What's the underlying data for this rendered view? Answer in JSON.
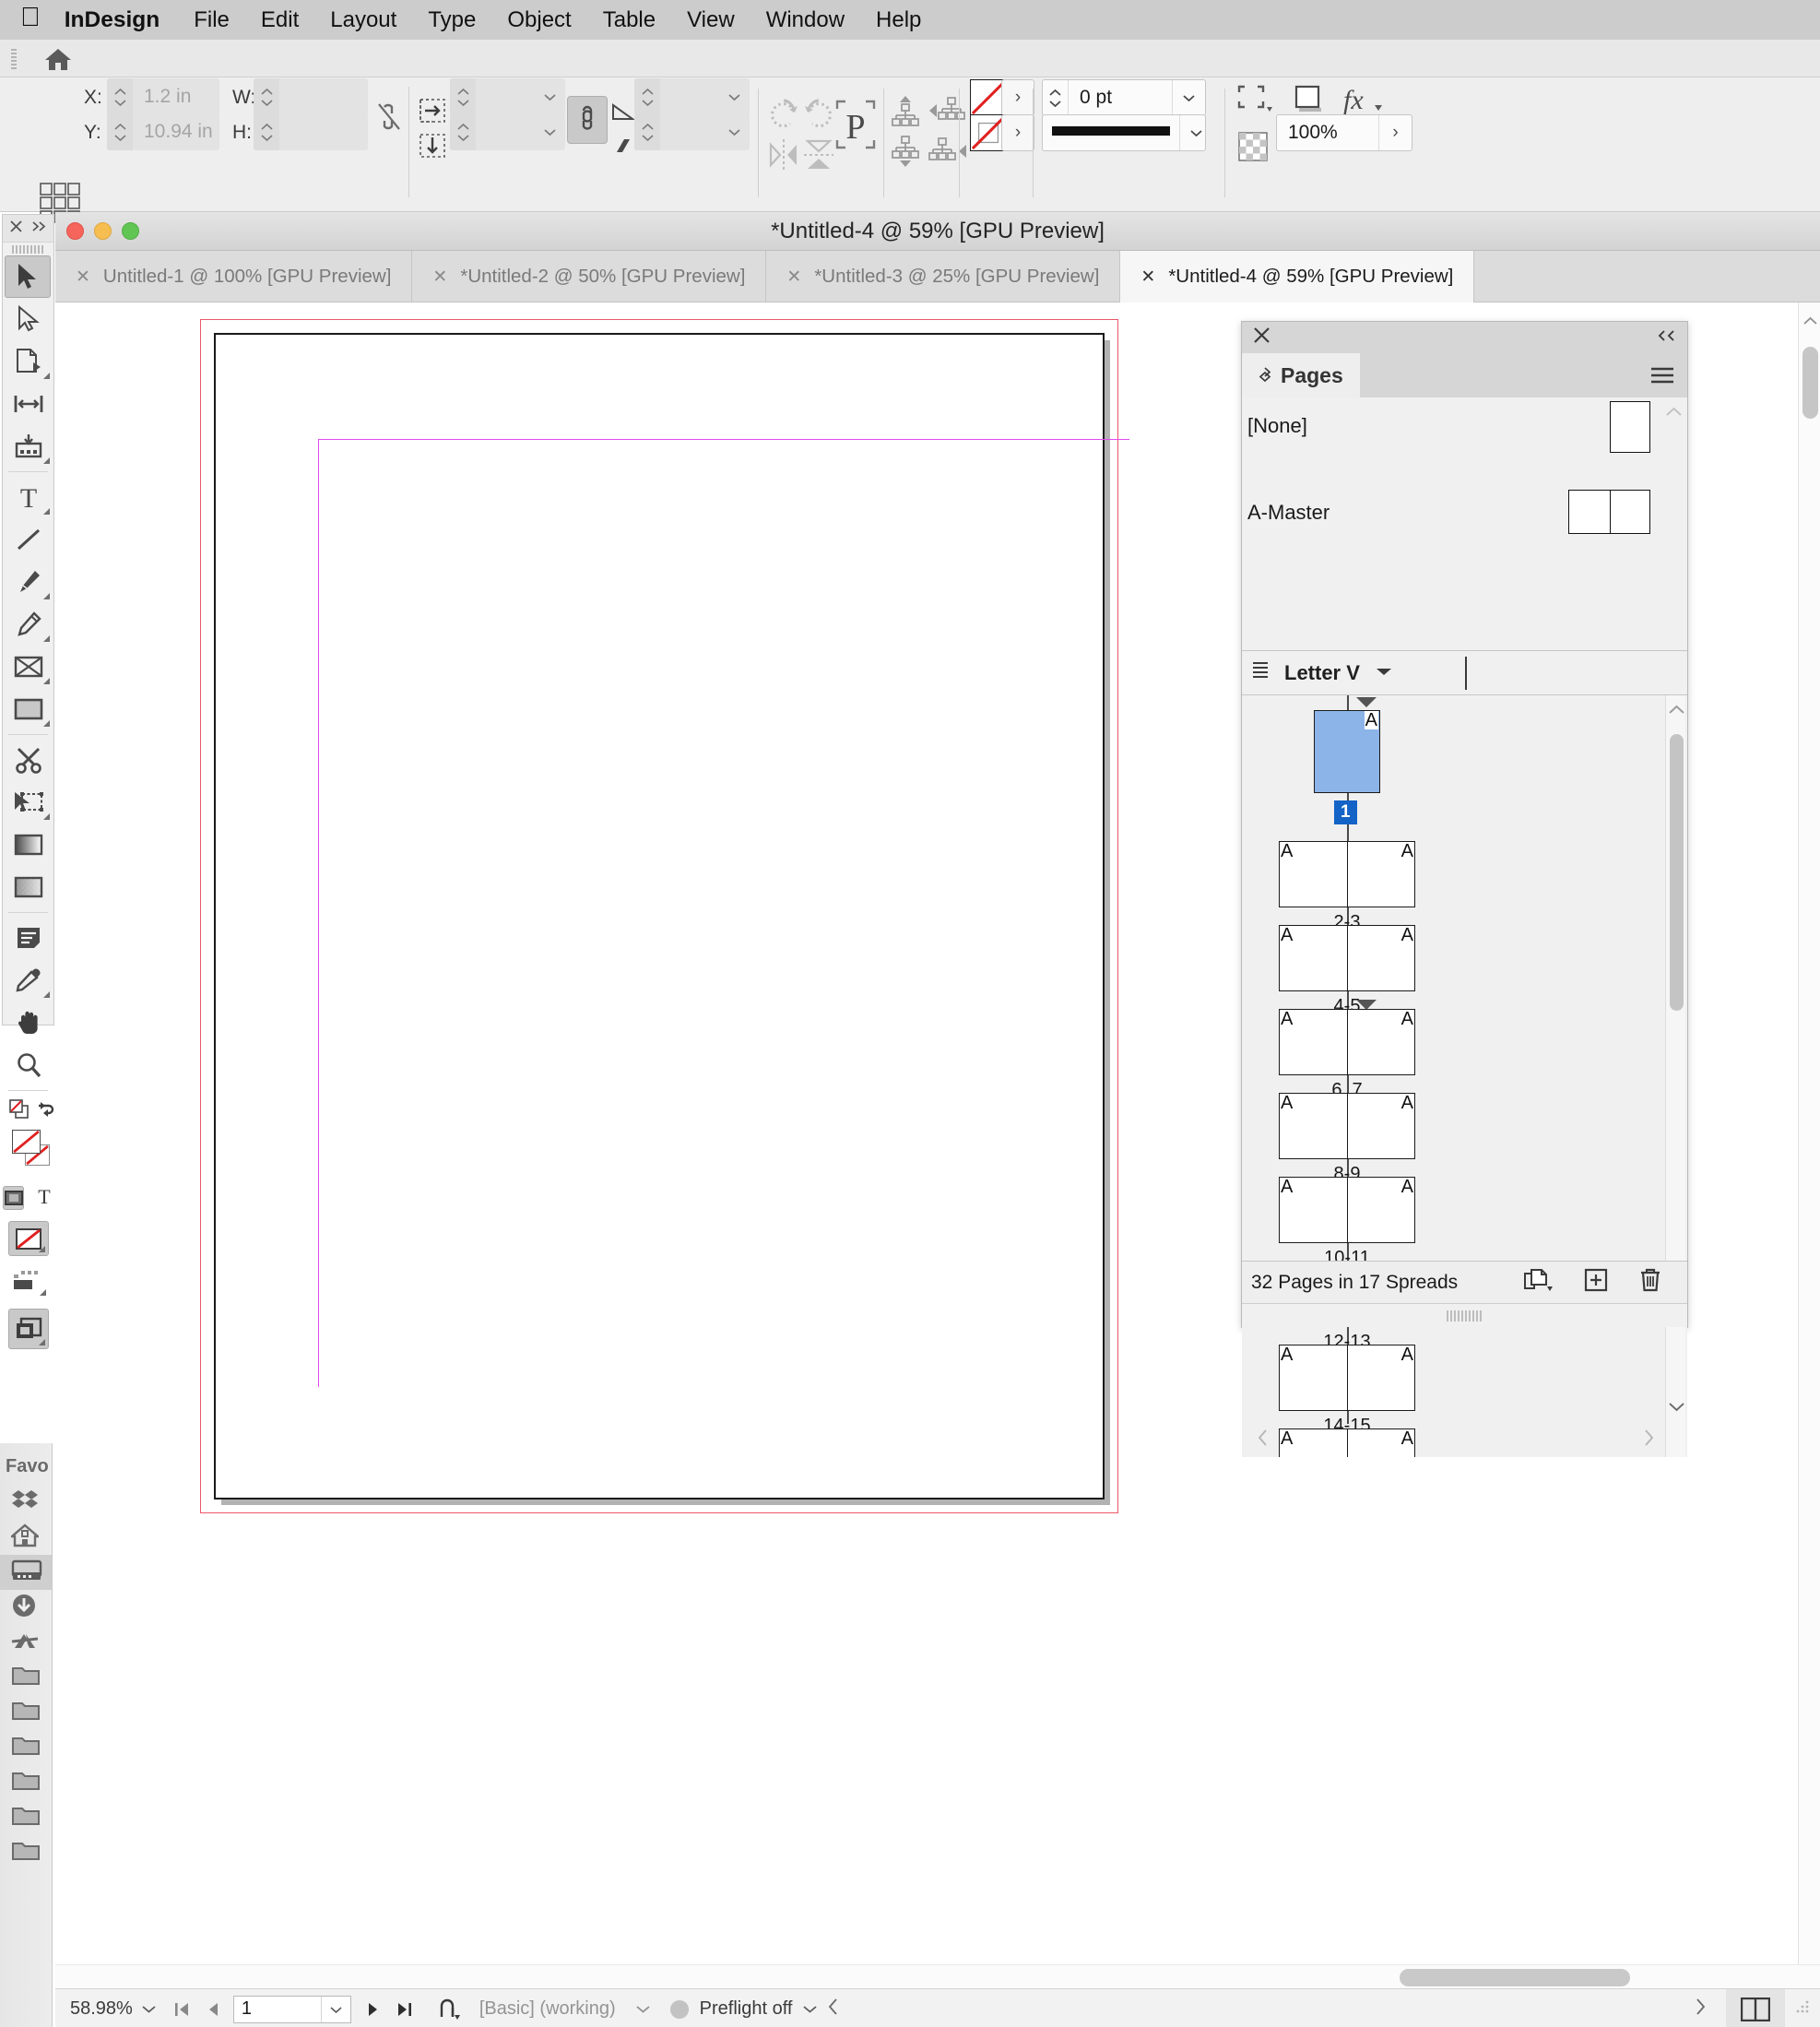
{
  "menubar": {
    "apple_icon": "apple-logo-icon",
    "items": [
      "InDesign",
      "File",
      "Edit",
      "Layout",
      "Type",
      "Object",
      "Table",
      "View",
      "Window",
      "Help"
    ]
  },
  "appbar": {
    "home_icon": "home-icon"
  },
  "control_panel": {
    "reference_point_icon": "reference-point-proxy-icon",
    "x_label": "X:",
    "x_value": "1.2 in",
    "y_label": "Y:",
    "y_value": "10.94 in",
    "w_label": "W:",
    "w_value": "",
    "h_label": "H:",
    "h_value": "",
    "constrain_icon": "broken-chain-link-icon",
    "scale_x_icon": "scale-horizontal-icon",
    "scale_y_icon": "scale-vertical-icon",
    "scale_x_value": "",
    "scale_y_value": "",
    "link_scale_icon": "chain-link-icon",
    "rotation_icon": "rotation-angle-icon",
    "rotation_value": "",
    "shear_icon": "shear-icon",
    "shear_value": "",
    "rotate_cw_icon": "rotate-clockwise-icon",
    "rotate_ccw_icon": "rotate-counterclockwise-icon",
    "flip_h_icon": "flip-horizontal-icon",
    "flip_v_icon": "flip-vertical-icon",
    "container_icon": "select-container-p-icon",
    "select_prev_icon": "select-previous-object-icon",
    "select_next_icon": "select-next-object-icon",
    "select_parent_icon": "select-parent-icon",
    "select_child_icon": "select-child-icon",
    "fill_swatch": "none-fill-icon",
    "stroke_swatch": "none-stroke-icon",
    "stroke_weight_value": "0 pt",
    "stroke_style_icon": "solid-stroke-line",
    "corner_options_icon": "corner-options-icon",
    "drop_shadow_icon": "drop-shadow-icon",
    "effects_icon": "fx-effects-icon",
    "opacity_icon": "transparency-grid-icon",
    "opacity_value": "100%"
  },
  "toolbox": {
    "close_icon": "close-icon",
    "expand_icon": "expand-panel-icon",
    "tools": [
      {
        "name": "selection-tool",
        "selected": true
      },
      {
        "name": "direct-selection-tool",
        "selected": false
      },
      {
        "name": "page-tool",
        "selected": false
      },
      {
        "name": "gap-tool",
        "selected": false
      },
      {
        "name": "content-collector-tool",
        "selected": false
      },
      {
        "name": "type-tool",
        "selected": false
      },
      {
        "name": "line-tool",
        "selected": false
      },
      {
        "name": "pen-tool",
        "selected": false
      },
      {
        "name": "pencil-tool",
        "selected": false
      },
      {
        "name": "frame-tool",
        "selected": false
      },
      {
        "name": "rectangle-tool",
        "selected": false
      },
      {
        "name": "scissors-tool",
        "selected": false
      },
      {
        "name": "free-transform-tool",
        "selected": false
      },
      {
        "name": "gradient-swatch-tool",
        "selected": false
      },
      {
        "name": "gradient-feather-tool",
        "selected": false
      },
      {
        "name": "note-tool",
        "selected": false
      },
      {
        "name": "eyedropper-tool",
        "selected": false
      },
      {
        "name": "hand-tool",
        "selected": false
      },
      {
        "name": "zoom-tool",
        "selected": false
      }
    ],
    "swap_fill_stroke_icon": "swap-fill-stroke-icon",
    "default_fill_stroke_icon": "default-fill-stroke-icon",
    "fill_box_icon": "fill-none-box-icon",
    "stroke_box_icon": "stroke-none-box-icon",
    "formatting_container_icon": "formatting-affects-container-icon",
    "formatting_text_icon": "formatting-affects-text-icon",
    "apply_none_icon": "apply-none-icon",
    "normal_view_icon": "normal-view-mode-icon",
    "preview_view_icon": "preview-view-mode-icon"
  },
  "finder_sidebar": {
    "title": "Favo",
    "items": [
      {
        "name": "dropbox-icon",
        "selected": false
      },
      {
        "name": "home-folder-icon",
        "selected": false
      },
      {
        "name": "desktop-icon",
        "selected": true
      },
      {
        "name": "downloads-icon",
        "selected": false
      },
      {
        "name": "applications-icon",
        "selected": false
      },
      {
        "name": "folder-icon",
        "selected": false
      },
      {
        "name": "folder-icon",
        "selected": false
      },
      {
        "name": "folder-icon",
        "selected": false
      },
      {
        "name": "folder-icon",
        "selected": false
      },
      {
        "name": "folder-icon",
        "selected": false
      },
      {
        "name": "folder-icon",
        "selected": false
      }
    ]
  },
  "document_window": {
    "title": "*Untitled-4 @ 59% [GPU Preview]",
    "traffic_lights": [
      "close-button",
      "minimize-button",
      "zoom-button"
    ],
    "tabs": [
      {
        "label": "Untitled-1 @ 100% [GPU Preview]",
        "active": false
      },
      {
        "label": "*Untitled-2 @ 50% [GPU Preview]",
        "active": false
      },
      {
        "label": "*Untitled-3 @ 25% [GPU Preview]",
        "active": false
      },
      {
        "label": "*Untitled-4 @ 59% [GPU Preview]",
        "active": true
      }
    ],
    "canvas": {
      "bleed_guide_color": "#ec5768",
      "page_border_color": "#1a1a1a",
      "margin_guide_color": "#e24bf0",
      "page_background": "#ffffff"
    },
    "status_bar": {
      "zoom_value": "58.98%",
      "zoom_chevron_icon": "chevron-down-icon",
      "first_page_icon": "first-page-icon",
      "prev_page_icon": "previous-page-icon",
      "page_number": "1",
      "page_dropdown_icon": "chevron-down-icon",
      "next_page_icon": "next-page-icon",
      "last_page_icon": "last-page-icon",
      "no_errors_icon": "no-errors-icon",
      "style_text": "[Basic] (working)",
      "style_chevron_icon": "chevron-down-icon",
      "preflight_status_icon": "preflight-status-dot",
      "preflight_text": "Preflight off",
      "preflight_chevron_icon": "chevron-down-icon",
      "collapse_left_icon": "chevron-left-icon",
      "expand_right_icon": "chevron-right-icon",
      "split_view_icon": "split-window-icon",
      "resize_grip_icon": "resize-grip-icon"
    },
    "vertical_scrollbar_icon": "scroll-up-arrow-icon"
  },
  "pages_panel": {
    "close_icon": "close-icon",
    "collapse_icon": "collapse-to-icons-icon",
    "tab_label": "Pages",
    "tab_diamond_icon": "panel-diamond-icon",
    "menu_icon": "panel-menu-hamburger-icon",
    "masters": [
      {
        "name": "[None]",
        "kind": "single"
      },
      {
        "name": "A-Master",
        "kind": "spread"
      }
    ],
    "page_size": {
      "list_icon": "page-size-list-icon",
      "label": "Letter V",
      "chevron_icon": "chevron-down-icon"
    },
    "spreads": [
      {
        "label": "",
        "pages": 1,
        "selected": true,
        "markers": [
          "A"
        ],
        "badge": "1",
        "triangle": true
      },
      {
        "label": "2-3",
        "pages": 2,
        "selected": false,
        "markers": [
          "A",
          "A"
        ],
        "triangle": false
      },
      {
        "label": "4-5",
        "pages": 2,
        "selected": false,
        "markers": [
          "A",
          "A"
        ],
        "triangle": false
      },
      {
        "label": "6, 7",
        "pages": 2,
        "selected": false,
        "markers": [
          "A",
          "A"
        ],
        "triangle": true
      },
      {
        "label": "8-9",
        "pages": 2,
        "selected": false,
        "markers": [
          "A",
          "A"
        ],
        "triangle": false
      },
      {
        "label": "10-11",
        "pages": 2,
        "selected": false,
        "markers": [
          "A",
          "A"
        ],
        "triangle": false
      },
      {
        "label": "12-13",
        "pages": 2,
        "selected": false,
        "markers": [
          "A",
          "A"
        ],
        "triangle": false
      },
      {
        "label": "14-15",
        "pages": 2,
        "selected": false,
        "markers": [
          "A",
          "A"
        ],
        "triangle": false
      },
      {
        "label": "",
        "pages": 2,
        "selected": false,
        "markers": [
          "A",
          "A"
        ],
        "triangle": false
      }
    ],
    "footer": {
      "count_text": "32 Pages in 17 Spreads",
      "edit_page_size_icon": "edit-page-size-icon",
      "new_page_icon": "new-page-icon",
      "delete_page_icon": "delete-page-trash-icon"
    },
    "scroll_left_icon": "chevron-left-icon",
    "scroll_right_icon": "chevron-right-icon",
    "scroll_down_icon": "chevron-down-icon",
    "scroll_up_icon": "chevron-up-icon",
    "resize_grip_icon": "resize-grip-icon"
  }
}
